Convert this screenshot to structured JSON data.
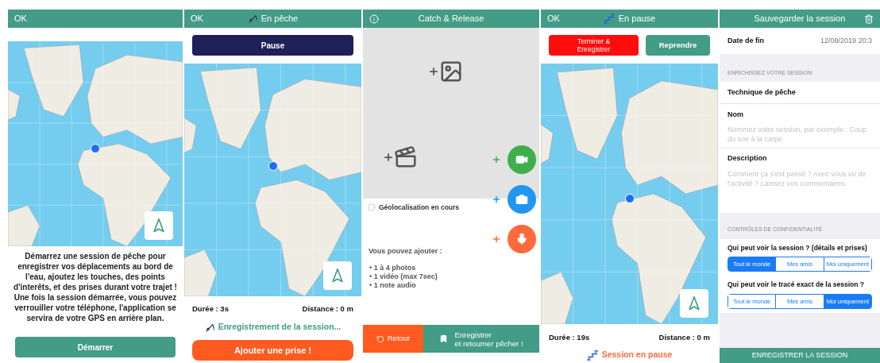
{
  "screens": [
    {
      "kind": "start",
      "header_button": "OK",
      "message": "Démarrez une session de pêche pour enregistrer vos déplacements au bord de l'eau, ajoutez les touches, des points d'interêts, et des prises durant votre trajet ! Une fois la session démarrée, vous pouvez verrouiller votre téléphone, l'application se servira de votre GPS en arrière plan.",
      "button": "Démarrer"
    },
    {
      "kind": "fishing",
      "header_button": "OK",
      "title": "En pêche",
      "pause_button": "Pause",
      "duration": "Durée : 3s",
      "distance": "Distance : 0 m",
      "status": "Enregistrement de la session...",
      "action_button": "Ajouter une prise !"
    },
    {
      "kind": "catch",
      "title": "Catch & Release",
      "geolocation": "Géolocalisation en cours",
      "media_intro": "Vous pouvez ajouter :",
      "media_items": [
        "• 1 à 4 photos",
        "• 1 vidéo (max 7sec)",
        "• 1 note audio"
      ],
      "back_button": "Retour",
      "save_button_lines": [
        "Enregistrer",
        "et retourner pêcher !"
      ]
    },
    {
      "kind": "paused",
      "header_button": "OK",
      "title": "En pause",
      "finish_button": "Terminer & Enregistrer",
      "resume_button": "Reprendre",
      "duration": "Durée : 19s",
      "distance": "Distance : 0 m",
      "status": "Session en pause"
    },
    {
      "kind": "save",
      "title": "Sauvegarder la session",
      "end_date": {
        "label": "Date de fin",
        "value": "12/08/2019 20:3"
      },
      "enrich_heading": "ENRICHISSEZ VOTRE SESSION",
      "technique_label": "Technique de pêche",
      "name": {
        "label": "Nom",
        "placeholder": "Nommez votre session, par exemple : Coup du soir à la carpe"
      },
      "description": {
        "label": "Description",
        "placeholder": "Comment ça s'est passé ? Avez-vous vu de l'activité ? Laissez vos commentaires."
      },
      "privacy_heading": "CONTRÔLES DE CONFIDENTIALITÉ",
      "questions": [
        {
          "label": "Qui peut voir la session ? (détails et prises)",
          "options": [
            {
              "label": "Tout le monde",
              "selected": true
            },
            {
              "label": "Mes amis",
              "selected": false
            },
            {
              "label": "Moi uniquement",
              "selected": false
            }
          ]
        },
        {
          "label": "Qui peut voir le tracé exact de la session ?",
          "options": [
            {
              "label": "Tout le monde",
              "selected": false
            },
            {
              "label": "Mes amis",
              "selected": false
            },
            {
              "label": "Moi uniquement",
              "selected": true
            }
          ]
        }
      ],
      "submit_button": "ENREGISTRER LA SESSION"
    }
  ]
}
